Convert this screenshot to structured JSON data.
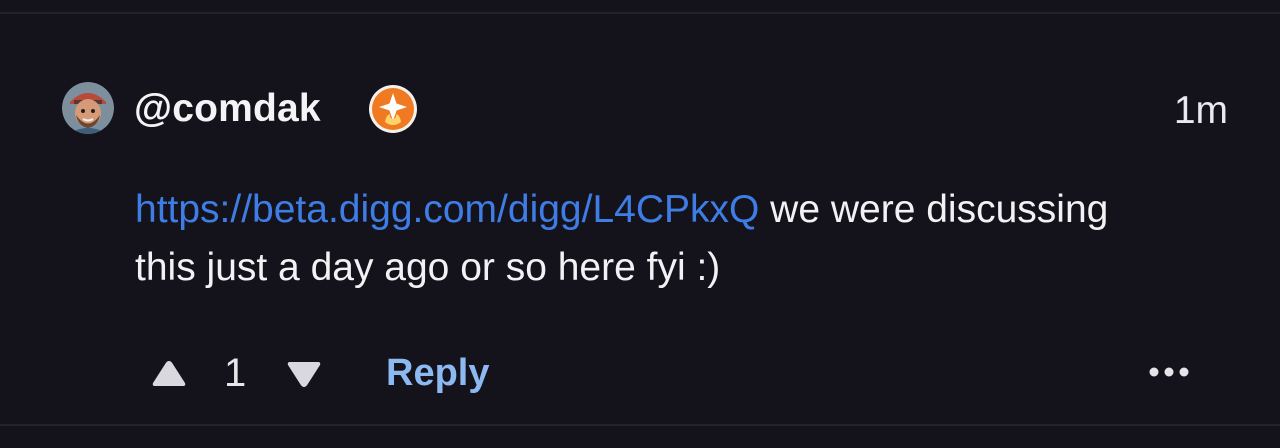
{
  "comment": {
    "username": "@comdak",
    "timestamp": "1m",
    "link_text": "https://beta.digg.com/digg/L4CPkxQ",
    "body_text": " we were discussing this just a day ago or so here fyi :)",
    "votes": "1",
    "reply_label": "Reply"
  },
  "icons": {
    "avatar": "avatar-image",
    "badge": "flame-sparkle-badge-icon",
    "upvote": "triangle-up-icon",
    "downvote": "triangle-down-icon",
    "more": "ellipsis-icon"
  },
  "colors": {
    "background": "#14131b",
    "link": "#3f7de6",
    "reply": "#8db9f2",
    "badge_orange": "#f07a22"
  }
}
